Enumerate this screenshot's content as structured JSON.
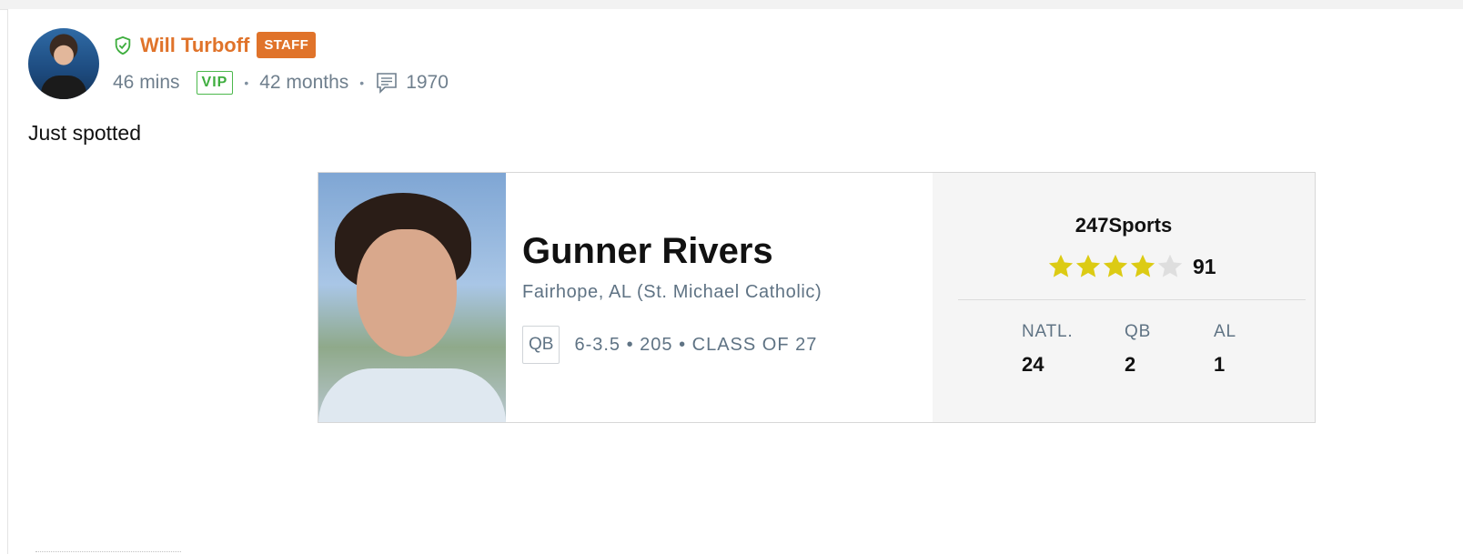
{
  "author": {
    "name": "Will Turboff",
    "badge": "STAFF",
    "time_ago": "46 mins",
    "membership": "VIP",
    "tenure": "42 months",
    "post_count": "1970"
  },
  "post": {
    "text": "Just spotted"
  },
  "player_card": {
    "name": "Gunner Rivers",
    "location": "Fairhope, AL (St. Michael Catholic)",
    "position": "QB",
    "details": "6-3.5 • 205 • CLASS OF 27",
    "rating_source": "247Sports",
    "stars": 4,
    "stars_max": 5,
    "rating": "91",
    "ranks": [
      {
        "label": "NATL.",
        "value": "24"
      },
      {
        "label": "QB",
        "value": "2"
      },
      {
        "label": "AL",
        "value": "1"
      }
    ]
  },
  "colors": {
    "accent_orange": "#e0732a",
    "vip_green": "#3fae3f",
    "star_gold": "#dccb14",
    "star_empty": "#dedede"
  },
  "icons": {
    "verified": "shield-check-icon",
    "comments": "comment-icon",
    "star": "star-icon"
  }
}
